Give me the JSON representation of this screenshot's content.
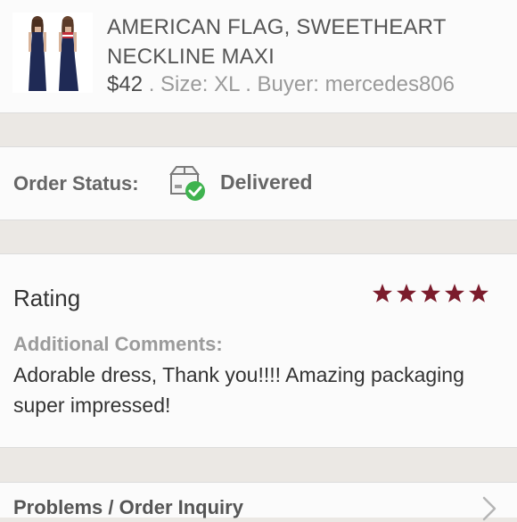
{
  "product": {
    "title": "AMERICAN FLAG, SWEETHEART NECKLINE MAXI",
    "price": "$42",
    "size": " . Size: XL . Buyer: mercedes806"
  },
  "order": {
    "status_label": "Order Status:",
    "status_value": "Delivered",
    "status_icon": "package-delivered-icon",
    "status_color": "#3fb34f"
  },
  "rating": {
    "title": "Rating",
    "stars": 5,
    "star_color": "#7b1c2c",
    "comments_label": "Additional Comments:",
    "comments_text": "Adorable dress, Thank you!!!! Amazing packaging super impressed!"
  },
  "inquiry": {
    "label": "Problems / Order Inquiry",
    "chevron_icon": "chevron-right-icon"
  }
}
